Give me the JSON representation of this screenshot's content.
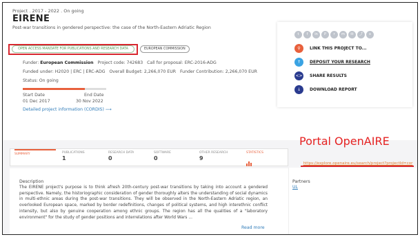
{
  "header": {
    "meta": "Project . 2017 - 2022 . On going",
    "title": "EIRENE",
    "subtitle": "Post-war transitions in gendered perspective: the case of the North-Eastern Adriatic Region"
  },
  "tags": {
    "open_access": "OPEN ACCESS MANDATE FOR PUBLICATIONS AND RESEARCH DATA",
    "funder_tag": "EUROPEAN COMMISSION"
  },
  "info": {
    "funder_label": "Funder:",
    "funder_value": "European Commission",
    "project_code": "Project code: 742683",
    "call": "Call for proposal: ERC-2016-ADG",
    "funded_under": "Funded under: H2020 | ERC | ERC-ADG",
    "budget": "Overall Budget: 2,266,070 EUR",
    "contribution": "Funder Contribution: 2,266,070 EUR",
    "status": "Status: On going",
    "start_label": "Start Date",
    "start_value": "01 Dec 2017",
    "end_label": "End Date",
    "end_value": "30 Nov 2022",
    "progress_fraction": 0.74,
    "detail_link": "Detailed project information (CORDIS) ⟶"
  },
  "actions": {
    "share_icons": [
      "twitter-icon",
      "facebook-icon",
      "linkedin-icon",
      "pinterest-icon",
      "reddit-icon",
      "mendeley-icon",
      "email-icon",
      "share-icon",
      "plus-icon"
    ],
    "share_glyphs": [
      "t",
      "f",
      "in",
      "P",
      "r",
      "m",
      "✉",
      "⤴",
      "+"
    ],
    "link": "LINK THIS PROJECT TO...",
    "deposit": "DEPOSIT YOUR RESEARCH",
    "share": "SHARE RESULTS",
    "download": "DOWNLOAD REPORT",
    "colors": {
      "link": "#e8603c",
      "deposit": "#3aa3e3",
      "share": "#2a3b8f",
      "download": "#2a3b8f"
    }
  },
  "annotation": {
    "portal": "Portal OpenAIRE",
    "url": "https://explore.openaire.eu/search/project?projectId=corda__h2020::c6f3d7c96ff6bd4b87a0b902ee3773bc2b"
  },
  "tabs": [
    {
      "label": "SUMMARY",
      "count": ""
    },
    {
      "label": "PUBLICATIONS",
      "count": "1"
    },
    {
      "label": "RESEARCH DATA",
      "count": "0"
    },
    {
      "label": "SOFTWARE",
      "count": "0"
    },
    {
      "label": "OTHER RESEARCH",
      "count": "9"
    },
    {
      "label": "STATISTICS",
      "count": ""
    }
  ],
  "summary": {
    "heading": "Description",
    "text": "The EIRENE project's purpose is to think afresh 20th-century post-war transitions by taking into account a gendered perspective. Namely, the historiographic consideration of gender thoroughly alters the understanding of social dynamics in multi-ethnic areas during the post-war transitions. They will be observed in the North-Eastern Adriatic region, an overlooked European space, marked by border redefinitions, changes of political systems, and high interethnic conflict intensity, but also by genuine cooperation among ethnic groups. The region has all the qualities of a \"laboratory environment\" for the study of gender positions and interrelations after World Wars ...",
    "read_more": "Read more"
  },
  "partners": {
    "heading": "Partners",
    "value": "UL"
  }
}
